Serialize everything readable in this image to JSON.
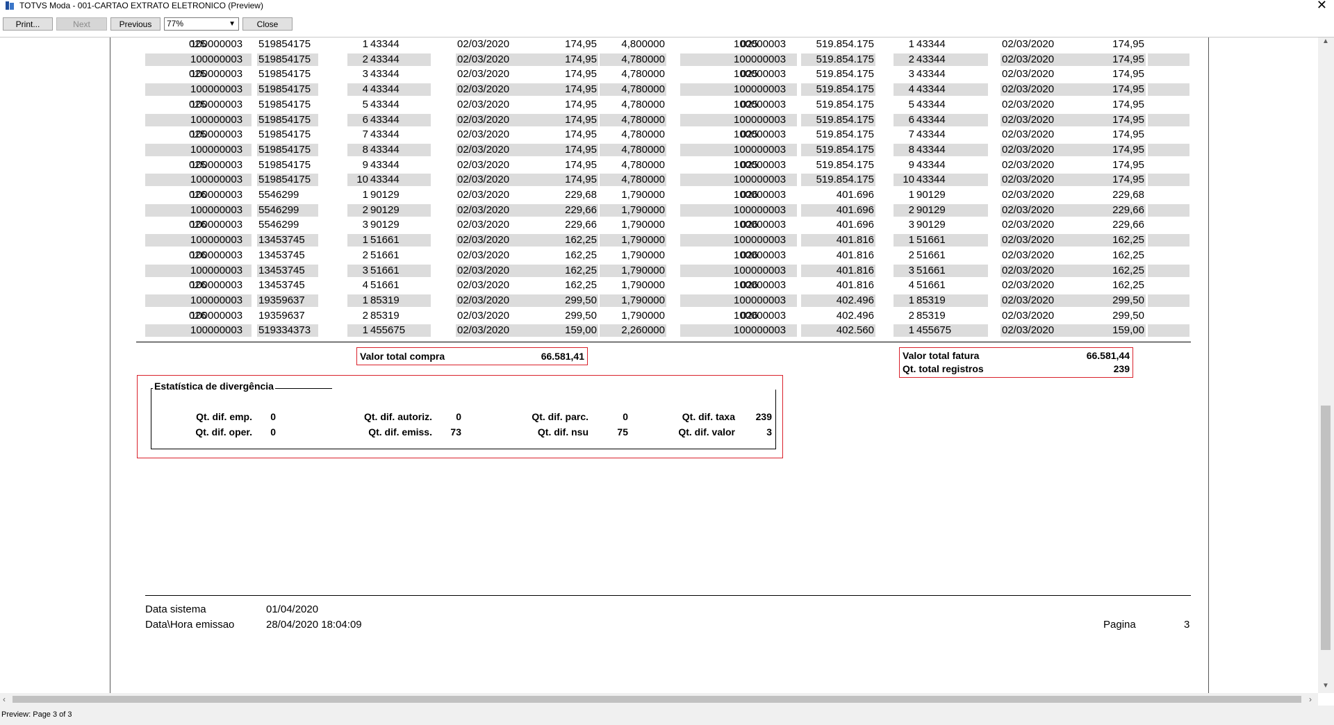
{
  "window": {
    "title": "TOTVS Moda - 001-CARTAO EXTRATO ELETRONICO (Preview)",
    "close_glyph": "✕"
  },
  "toolbar": {
    "print_label": "Print...",
    "next_label": "Next",
    "previous_label": "Previous",
    "zoom_value": "77%",
    "close_label": "Close"
  },
  "report": {
    "rows": [
      [
        "025",
        "100000003",
        "519854175",
        "1",
        "43344",
        "02/03/2020",
        "174,95",
        "4,800000",
        "025",
        "100000003",
        "519.854.175",
        "1",
        "43344",
        "02/03/2020",
        "174,95"
      ],
      [
        "025",
        "100000003",
        "519854175",
        "2",
        "43344",
        "02/03/2020",
        "174,95",
        "4,780000",
        "025",
        "100000003",
        "519.854.175",
        "2",
        "43344",
        "02/03/2020",
        "174,95"
      ],
      [
        "025",
        "100000003",
        "519854175",
        "3",
        "43344",
        "02/03/2020",
        "174,95",
        "4,780000",
        "025",
        "100000003",
        "519.854.175",
        "3",
        "43344",
        "02/03/2020",
        "174,95"
      ],
      [
        "025",
        "100000003",
        "519854175",
        "4",
        "43344",
        "02/03/2020",
        "174,95",
        "4,780000",
        "025",
        "100000003",
        "519.854.175",
        "4",
        "43344",
        "02/03/2020",
        "174,95"
      ],
      [
        "025",
        "100000003",
        "519854175",
        "5",
        "43344",
        "02/03/2020",
        "174,95",
        "4,780000",
        "025",
        "100000003",
        "519.854.175",
        "5",
        "43344",
        "02/03/2020",
        "174,95"
      ],
      [
        "025",
        "100000003",
        "519854175",
        "6",
        "43344",
        "02/03/2020",
        "174,95",
        "4,780000",
        "025",
        "100000003",
        "519.854.175",
        "6",
        "43344",
        "02/03/2020",
        "174,95"
      ],
      [
        "025",
        "100000003",
        "519854175",
        "7",
        "43344",
        "02/03/2020",
        "174,95",
        "4,780000",
        "025",
        "100000003",
        "519.854.175",
        "7",
        "43344",
        "02/03/2020",
        "174,95"
      ],
      [
        "025",
        "100000003",
        "519854175",
        "8",
        "43344",
        "02/03/2020",
        "174,95",
        "4,780000",
        "025",
        "100000003",
        "519.854.175",
        "8",
        "43344",
        "02/03/2020",
        "174,95"
      ],
      [
        "025",
        "100000003",
        "519854175",
        "9",
        "43344",
        "02/03/2020",
        "174,95",
        "4,780000",
        "025",
        "100000003",
        "519.854.175",
        "9",
        "43344",
        "02/03/2020",
        "174,95"
      ],
      [
        "025",
        "100000003",
        "519854175",
        "10",
        "43344",
        "02/03/2020",
        "174,95",
        "4,780000",
        "025",
        "100000003",
        "519.854.175",
        "10",
        "43344",
        "02/03/2020",
        "174,95"
      ],
      [
        "026",
        "100000003",
        "5546299",
        "1",
        "90129",
        "02/03/2020",
        "229,68",
        "1,790000",
        "026",
        "100000003",
        "401.696",
        "1",
        "90129",
        "02/03/2020",
        "229,68"
      ],
      [
        "026",
        "100000003",
        "5546299",
        "2",
        "90129",
        "02/03/2020",
        "229,66",
        "1,790000",
        "026",
        "100000003",
        "401.696",
        "2",
        "90129",
        "02/03/2020",
        "229,66"
      ],
      [
        "026",
        "100000003",
        "5546299",
        "3",
        "90129",
        "02/03/2020",
        "229,66",
        "1,790000",
        "026",
        "100000003",
        "401.696",
        "3",
        "90129",
        "02/03/2020",
        "229,66"
      ],
      [
        "026",
        "100000003",
        "13453745",
        "1",
        "51661",
        "02/03/2020",
        "162,25",
        "1,790000",
        "026",
        "100000003",
        "401.816",
        "1",
        "51661",
        "02/03/2020",
        "162,25"
      ],
      [
        "026",
        "100000003",
        "13453745",
        "2",
        "51661",
        "02/03/2020",
        "162,25",
        "1,790000",
        "026",
        "100000003",
        "401.816",
        "2",
        "51661",
        "02/03/2020",
        "162,25"
      ],
      [
        "026",
        "100000003",
        "13453745",
        "3",
        "51661",
        "02/03/2020",
        "162,25",
        "1,790000",
        "026",
        "100000003",
        "401.816",
        "3",
        "51661",
        "02/03/2020",
        "162,25"
      ],
      [
        "026",
        "100000003",
        "13453745",
        "4",
        "51661",
        "02/03/2020",
        "162,25",
        "1,790000",
        "026",
        "100000003",
        "401.816",
        "4",
        "51661",
        "02/03/2020",
        "162,25"
      ],
      [
        "026",
        "100000003",
        "19359637",
        "1",
        "85319",
        "02/03/2020",
        "299,50",
        "1,790000",
        "026",
        "100000003",
        "402.496",
        "1",
        "85319",
        "02/03/2020",
        "299,50"
      ],
      [
        "026",
        "100000003",
        "19359637",
        "2",
        "85319",
        "02/03/2020",
        "299,50",
        "1,790000",
        "026",
        "100000003",
        "402.496",
        "2",
        "85319",
        "02/03/2020",
        "299,50"
      ],
      [
        "026",
        "100000003",
        "519334373",
        "1",
        "455675",
        "02/03/2020",
        "159,00",
        "2,260000",
        "026",
        "100000003",
        "402.560",
        "1",
        "455675",
        "02/03/2020",
        "159,00"
      ]
    ],
    "totals": {
      "compra_label": "Valor total compra",
      "compra_value": "66.581,41",
      "fatura_label": "Valor total fatura",
      "fatura_value": "66.581,44",
      "registros_label": "Qt. total registros",
      "registros_value": "239"
    },
    "stats": {
      "title": "Estatística de divergência",
      "dif_emp_label": "Qt. dif. emp.",
      "dif_emp_value": "0",
      "dif_autoriz_label": "Qt. dif. autoriz.",
      "dif_autoriz_value": "0",
      "dif_parc_label": "Qt. dif. parc.",
      "dif_parc_value": "0",
      "dif_taxa_label": "Qt. dif. taxa",
      "dif_taxa_value": "239",
      "dif_oper_label": "Qt. dif. oper.",
      "dif_oper_value": "0",
      "dif_emiss_label": "Qt. dif. emiss.",
      "dif_emiss_value": "73",
      "dif_nsu_label": "Qt. dif. nsu",
      "dif_nsu_value": "75",
      "dif_valor_label": "Qt. dif. valor",
      "dif_valor_value": "3"
    },
    "footer": {
      "data_sistema_label": "Data sistema",
      "data_sistema_value": "01/04/2020",
      "emissao_label": "Data\\Hora emissao",
      "emissao_value": "28/04/2020 18:04:09",
      "pagina_label": "Pagina",
      "pagina_value": "3"
    }
  },
  "status": {
    "text": "Preview: Page 3 of 3"
  }
}
